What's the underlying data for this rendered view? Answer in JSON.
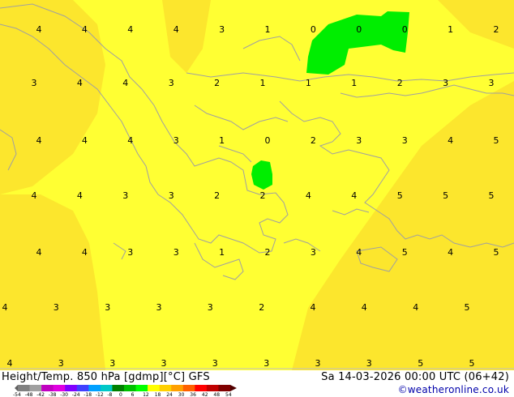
{
  "map": {
    "model": "GFS",
    "parameter": "Height/Temp. 850 hPa [gdmp][°C]",
    "fill_colors": {
      "background": "#ffff33",
      "darker_yellow": "#fce62d",
      "green": "#00ee00",
      "coastline": "#a0a0a0"
    },
    "temperature_labels": [
      [
        "4",
        "4",
        "4",
        "4",
        "3",
        "1",
        "0",
        "0",
        "0",
        "1",
        "2"
      ],
      [
        "3",
        "4",
        "4",
        "3",
        "2",
        "1",
        "1",
        "1",
        "2",
        "3",
        "3"
      ],
      [
        "4",
        "4",
        "4",
        "3",
        "1",
        "0",
        "2",
        "3",
        "3",
        "4",
        "5"
      ],
      [
        "4",
        "4",
        "3",
        "3",
        "2",
        "2",
        "4",
        "4",
        "5",
        "5",
        "5"
      ],
      [
        "4",
        "4",
        "3",
        "3",
        "1",
        "2",
        "3",
        "4",
        "5",
        "4",
        "5"
      ],
      [
        "4",
        "3",
        "3",
        "3",
        "3",
        "2",
        "4",
        "4",
        "4",
        "5"
      ],
      [
        "4",
        "3",
        "3",
        "3",
        "3",
        "3",
        "3",
        "3",
        "5",
        "5"
      ]
    ]
  },
  "footer": {
    "title": "Height/Temp. 850 hPa [gdmp][°C] GFS",
    "datetime": "Sa 14-03-2026 00:00 UTC (06+42)",
    "credit": "©weatheronline.co.uk",
    "colorbar_labels": [
      "-54",
      "-48",
      "-42",
      "-38",
      "-30",
      "-24",
      "-18",
      "-12",
      "-8",
      "0",
      "6",
      "12",
      "18",
      "24",
      "30",
      "36",
      "42",
      "48",
      "54"
    ],
    "colorbar_colors": [
      "#808080",
      "#a0a0a0",
      "#c000c0",
      "#e000e0",
      "#8000ff",
      "#4040ff",
      "#00a0ff",
      "#00c8c8",
      "#008000",
      "#00c000",
      "#00ff00",
      "#ffff00",
      "#ffd000",
      "#ffa000",
      "#ff6000",
      "#ff0000",
      "#c00000",
      "#800000"
    ]
  }
}
